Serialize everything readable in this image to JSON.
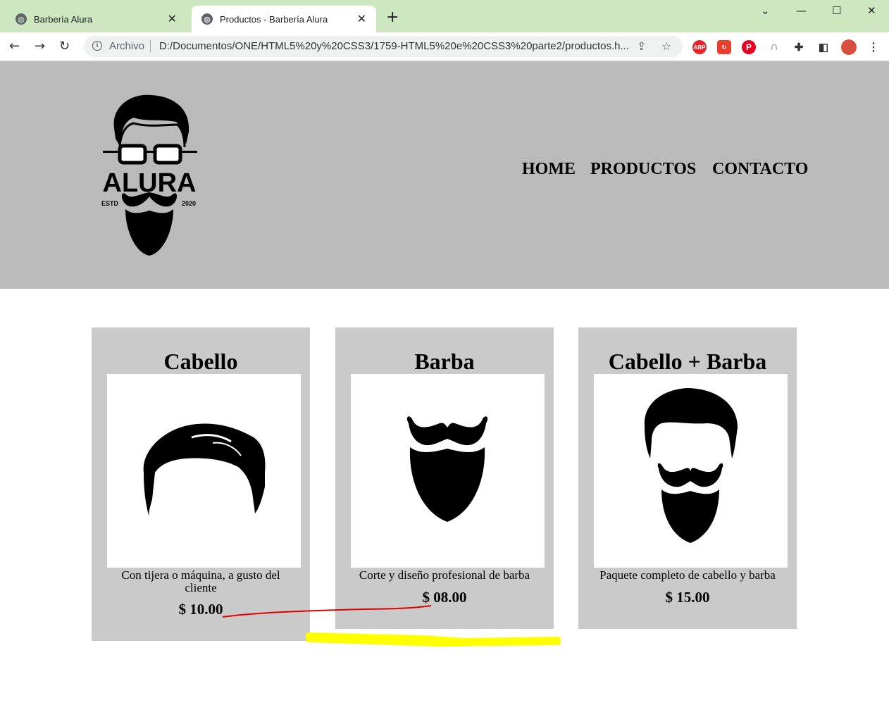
{
  "browser": {
    "tabs": [
      {
        "title": "Barbería Alura",
        "active": false
      },
      {
        "title": "Productos - Barbería Alura",
        "active": true
      }
    ],
    "address": {
      "scheme_label": "Archivo",
      "url": "D:/Documentos/ONE/HTML5%20y%20CSS3/1759-HTML5%20e%20CSS3%20parte2/productos.h..."
    },
    "extensions": [
      {
        "name": "adblock",
        "label": "ABP",
        "color": "#e2262a"
      },
      {
        "name": "sync",
        "label": "",
        "color": "#e8402e"
      },
      {
        "name": "pinterest",
        "label": "P",
        "color": "#e60023"
      }
    ]
  },
  "site": {
    "logo": {
      "brand": "ALURA",
      "estd": "ESTD",
      "year": "2020"
    },
    "nav": [
      "HOME",
      "PRODUCTOS",
      "CONTACTO"
    ]
  },
  "products": [
    {
      "title": "Cabello",
      "description": "Con tijera o máquina, a gusto del cliente",
      "price": "$ 10.00",
      "image": "hair-icon"
    },
    {
      "title": "Barba",
      "description": "Corte y diseño profesional de barba",
      "price": "$ 08.00",
      "image": "beard-icon"
    },
    {
      "title": "Cabello + Barba",
      "description": "Paquete completo de cabello y barba",
      "price": "$ 15.00",
      "image": "hair-beard-icon"
    }
  ],
  "colors": {
    "tabstrip": "#cde8c1",
    "header": "#bababa",
    "card": "#cacaca",
    "annotation_red": "#e00000",
    "annotation_yellow": "#ffff00"
  }
}
